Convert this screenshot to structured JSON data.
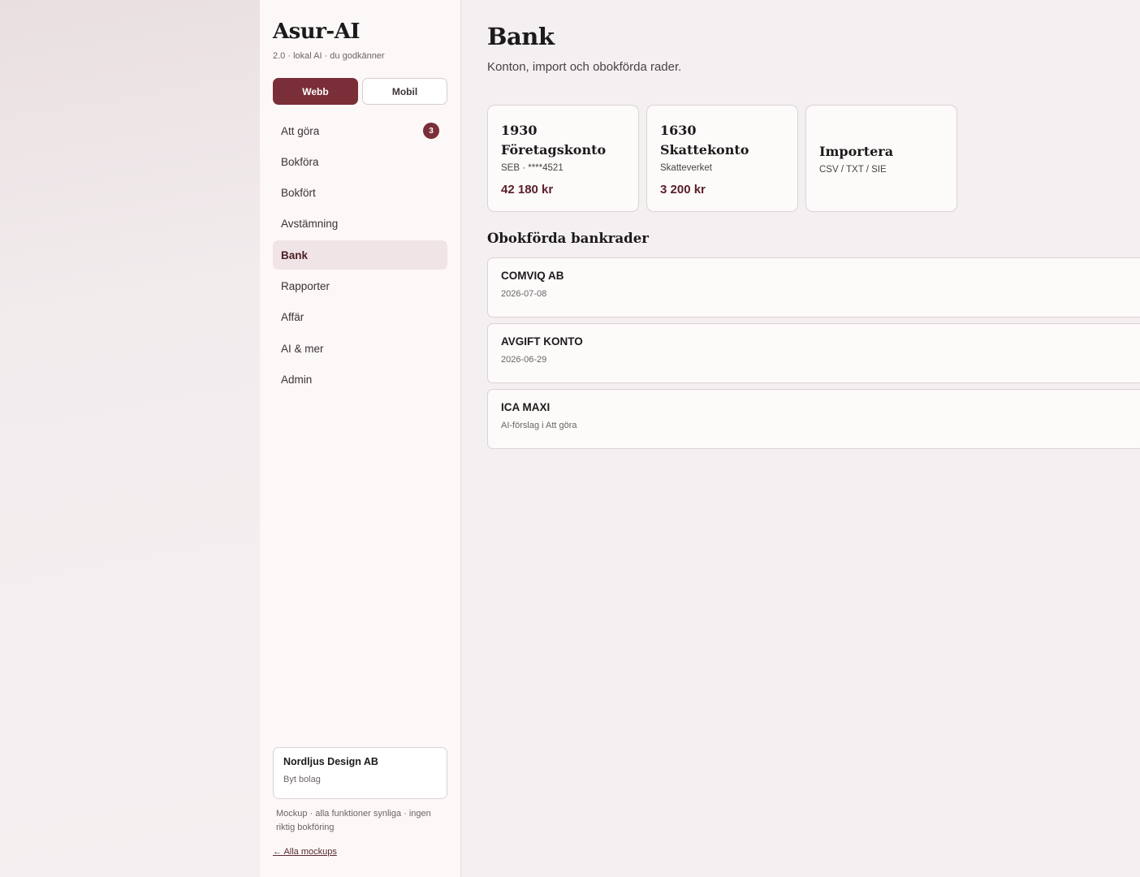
{
  "brand": {
    "name": "Asur-AI",
    "subtitle": "2.0 · lokal AI · du godkänner"
  },
  "view_toggle": {
    "web": "Webb",
    "mobile": "Mobil"
  },
  "nav": [
    {
      "label": "Att göra",
      "badge": "3"
    },
    {
      "label": "Bokföra"
    },
    {
      "label": "Bokfört"
    },
    {
      "label": "Avstämning"
    },
    {
      "label": "Bank"
    },
    {
      "label": "Rapporter"
    },
    {
      "label": "Affär"
    },
    {
      "label": "AI & mer"
    },
    {
      "label": "Admin"
    }
  ],
  "company": {
    "name": "Nordljus Design AB",
    "action": "Byt bolag"
  },
  "footer": {
    "note": "Mockup · alla funktioner synliga · ingen riktig bokföring",
    "link": "← Alla mockups"
  },
  "page": {
    "title": "Bank",
    "subtitle": "Konton, import och obokförda rader."
  },
  "cards": [
    {
      "title": "1930 Företagskonto",
      "sub": "SEB · ****4521",
      "amount": "42 180 kr"
    },
    {
      "title": "1630 Skattekonto",
      "sub": "Skatteverket",
      "amount": "3 200 kr"
    },
    {
      "title": "Importera",
      "sub": "CSV / TXT / SIE"
    }
  ],
  "section": {
    "title": "Obokförda bankrader"
  },
  "rows": [
    {
      "title": "COMVIQ AB",
      "sub": "2026-07-08"
    },
    {
      "title": "AVGIFT KONTO",
      "sub": "2026-06-29"
    },
    {
      "title": "ICA MAXI",
      "sub": "AI-förslag i Att göra"
    }
  ],
  "colors": {
    "accent": "#7a2e37",
    "active_nav_bg": "#f0e4e6"
  }
}
